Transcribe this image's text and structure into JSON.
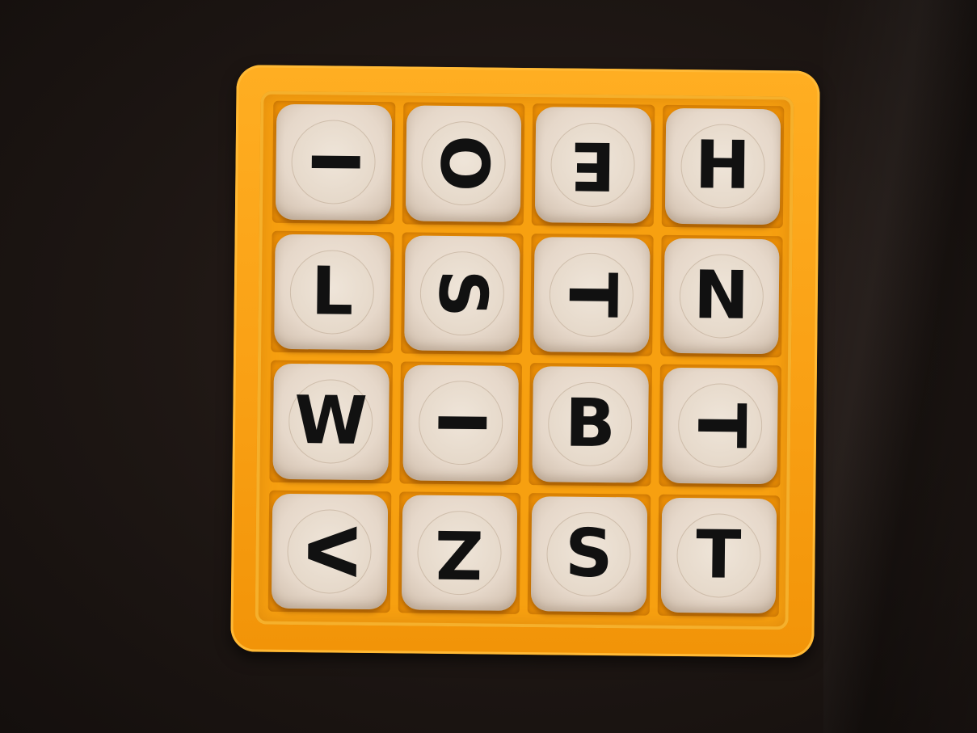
{
  "board": {
    "colors": {
      "tray": "#f9a014",
      "die": "#e9dccf",
      "letter": "#111111",
      "background": "#1d1613"
    },
    "dice": [
      {
        "letter": "I",
        "rotation": 90
      },
      {
        "letter": "O",
        "rotation": 90
      },
      {
        "letter": "E",
        "rotation": 180
      },
      {
        "letter": "H",
        "rotation": 0
      },
      {
        "letter": "L",
        "rotation": 0
      },
      {
        "letter": "S",
        "rotation": 90
      },
      {
        "letter": "T",
        "rotation": 90
      },
      {
        "letter": "N",
        "rotation": 0
      },
      {
        "letter": "W",
        "rotation": 0
      },
      {
        "letter": "I",
        "rotation": 90
      },
      {
        "letter": "B",
        "rotation": 0
      },
      {
        "letter": "T",
        "rotation": 90
      },
      {
        "letter": "V",
        "rotation": 90
      },
      {
        "letter": "Z",
        "rotation": 180
      },
      {
        "letter": "S",
        "rotation": 0
      },
      {
        "letter": "T",
        "rotation": 0
      }
    ]
  }
}
